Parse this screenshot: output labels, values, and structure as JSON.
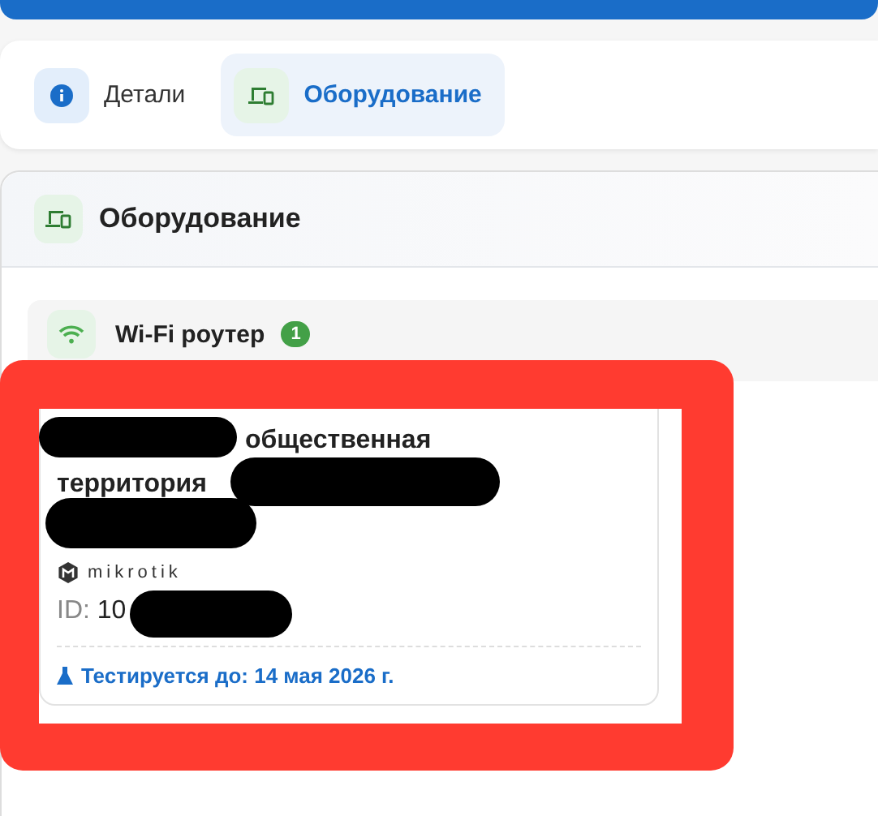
{
  "tabs": [
    {
      "label": "Детали",
      "selected": false
    },
    {
      "label": "Оборудование",
      "selected": true
    }
  ],
  "panel": {
    "title": "Оборудование"
  },
  "group": {
    "title": "Wi-Fi роутер",
    "count": "1"
  },
  "device": {
    "title_lines": [
      "общественная",
      "территория"
    ],
    "brand": "mikrotik",
    "id_label": "ID:",
    "id_value": "10",
    "testing": "Тестируется до: 14 мая 2026 г."
  }
}
